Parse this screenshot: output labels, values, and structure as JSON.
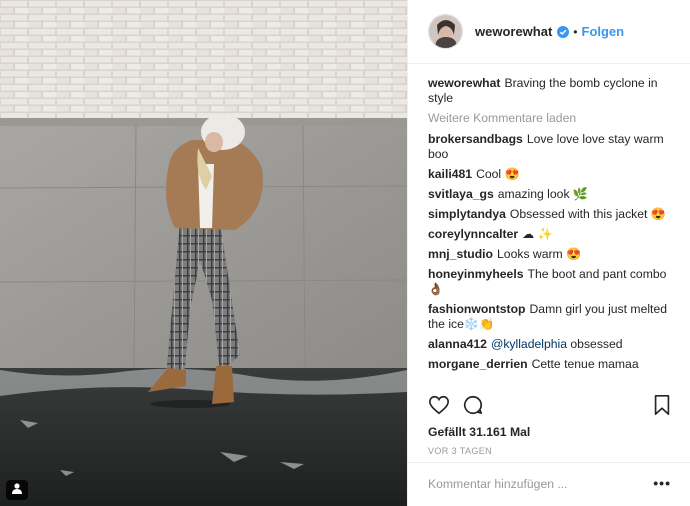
{
  "post": {
    "username": "weworewhat",
    "follow_label": "Folgen",
    "dot": "•",
    "caption_user": "weworewhat",
    "caption_text": "Braving the bomb cyclone in style",
    "load_more": "Weitere Kommentare laden",
    "comments": [
      {
        "user": "brokersandbags",
        "text": "Love love love stay warm boo"
      },
      {
        "user": "kaili481",
        "text": "Cool 😍"
      },
      {
        "user": "svitlaya_gs",
        "text": "amazing look 🌿"
      },
      {
        "user": "simplytandya",
        "text": "Obsessed with this jacket 😍"
      },
      {
        "user": "coreylynncalter",
        "text": "☁ ✨"
      },
      {
        "user": "mnj_studio",
        "text": "Looks warm 😍"
      },
      {
        "user": "honeyinmyheels",
        "text": "The boot and pant combo 👌🏾"
      },
      {
        "user": "fashionwontstop",
        "text": "Damn girl you just melted the ice❄️👏"
      },
      {
        "user": "alanna412",
        "mention": "@kylladelphia",
        "text": " obsessed"
      },
      {
        "user": "morgane_derrien",
        "text": "Cette tenue mamaa"
      }
    ],
    "likes": "Gefällt 31.161 Mal",
    "time": "VOR 3 TAGEN",
    "comment_placeholder": "Kommentar hinzufügen ...",
    "more_label": "•••"
  },
  "colors": {
    "accent": "#3897f0",
    "text": "#262626",
    "muted": "#999999",
    "border": "#efefef"
  },
  "icons": {
    "like": "heart-icon",
    "comment": "comment-bubble-icon",
    "save": "bookmark-icon",
    "verified": "verified-badge-icon",
    "tagged": "person-tag-icon"
  }
}
